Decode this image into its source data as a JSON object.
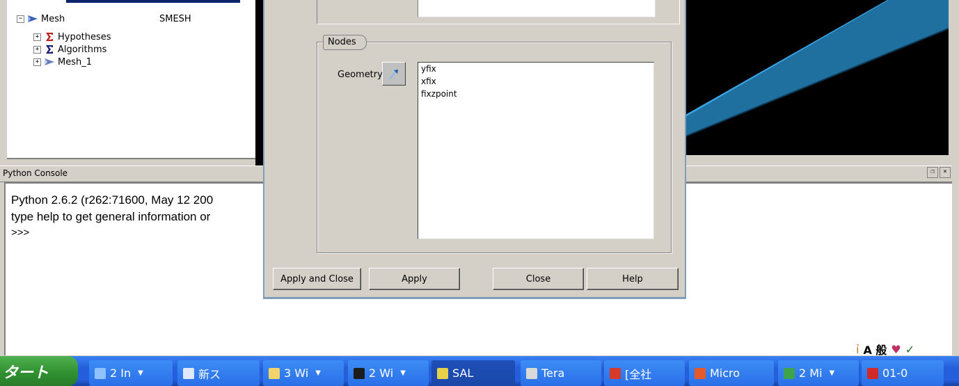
{
  "object_browser": {
    "rows": [
      {
        "label": "Mesh",
        "col2": "SMESH",
        "expander": "−"
      },
      {
        "label": "Hypotheses",
        "expander": "+"
      },
      {
        "label": "Algorithms",
        "expander": "+"
      },
      {
        "label": "Mesh_1",
        "expander": "+"
      }
    ]
  },
  "console": {
    "title": "Python Console",
    "lines": [
      "Python 2.6.2 (r262:71600, May 12 200",
      "type help to get general information or",
      ">>>"
    ]
  },
  "dialog": {
    "nodes_tab": "Nodes",
    "geometry_label": "Geometry",
    "geometry_items": [
      "yfix",
      "xfix",
      "fixzpoint"
    ],
    "buttons": {
      "apply_and_close": "Apply and Close",
      "apply": "Apply",
      "close": "Close",
      "help": "Help"
    }
  },
  "status_area": {
    "text": "A 般"
  },
  "taskbar": {
    "start": "タート",
    "items": [
      {
        "label": "2 In",
        "icon_color": "#8ec1ff",
        "arrow": true
      },
      {
        "label": "新ス",
        "icon_color": "#dfe8ff",
        "arrow": false
      },
      {
        "label": "3 Wi",
        "icon_color": "#f4d36b",
        "arrow": true
      },
      {
        "label": "2 Wi",
        "icon_color": "#1d1d1d",
        "arrow": true
      },
      {
        "label": "SAL",
        "icon_color": "#e6d14a",
        "arrow": false
      },
      {
        "label": "Tera",
        "icon_color": "#d9d9d9",
        "arrow": false
      },
      {
        "label": "[全社",
        "icon_color": "#d63a2a",
        "arrow": false
      },
      {
        "label": "Micro",
        "icon_color": "#e55a2a",
        "arrow": false
      },
      {
        "label": "2 Mi",
        "icon_color": "#3fa34d",
        "arrow": true
      },
      {
        "label": "01-0",
        "icon_color": "#d02a2a",
        "arrow": false
      }
    ]
  },
  "colors": {
    "viewer_bg": "#000000",
    "mesh_face": "#1f6f9f",
    "taskbar": "#245edb",
    "start": "#2f8f2f"
  }
}
